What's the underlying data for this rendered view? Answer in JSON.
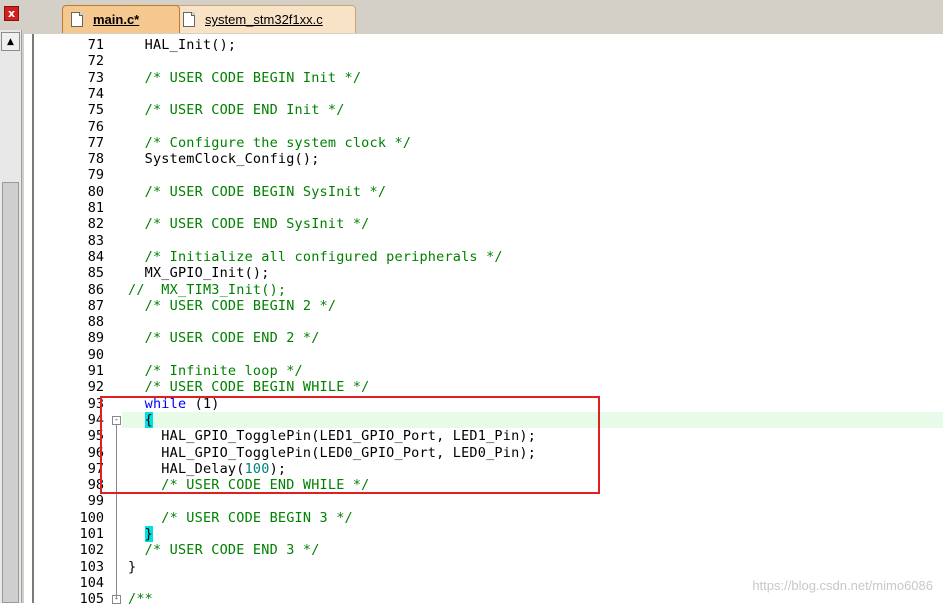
{
  "tabs": [
    {
      "label": "main.c*",
      "active": true
    },
    {
      "label": "system_stm32f1xx.c",
      "active": false
    }
  ],
  "close_label": "x",
  "scroll_up_glyph": "▲",
  "lines": [
    {
      "n": "71",
      "parts": [
        {
          "t": "  HAL_Init();",
          "c": "plain"
        }
      ]
    },
    {
      "n": "72",
      "parts": []
    },
    {
      "n": "73",
      "parts": [
        {
          "t": "  /* USER CODE BEGIN Init */",
          "c": "comment"
        }
      ]
    },
    {
      "n": "74",
      "parts": []
    },
    {
      "n": "75",
      "parts": [
        {
          "t": "  /* USER CODE END Init */",
          "c": "comment"
        }
      ]
    },
    {
      "n": "76",
      "parts": []
    },
    {
      "n": "77",
      "parts": [
        {
          "t": "  /* Configure the system clock */",
          "c": "comment"
        }
      ]
    },
    {
      "n": "78",
      "parts": [
        {
          "t": "  SystemClock_Config();",
          "c": "plain"
        }
      ]
    },
    {
      "n": "79",
      "parts": []
    },
    {
      "n": "80",
      "parts": [
        {
          "t": "  /* USER CODE BEGIN SysInit */",
          "c": "comment"
        }
      ]
    },
    {
      "n": "81",
      "parts": []
    },
    {
      "n": "82",
      "parts": [
        {
          "t": "  /* USER CODE END SysInit */",
          "c": "comment"
        }
      ]
    },
    {
      "n": "83",
      "parts": []
    },
    {
      "n": "84",
      "parts": [
        {
          "t": "  /* Initialize all configured peripherals */",
          "c": "comment"
        }
      ]
    },
    {
      "n": "85",
      "parts": [
        {
          "t": "  MX_GPIO_Init();",
          "c": "plain"
        }
      ]
    },
    {
      "n": "86",
      "parts": [
        {
          "t": "//  MX_TIM3_Init();",
          "c": "comment"
        }
      ]
    },
    {
      "n": "87",
      "parts": [
        {
          "t": "  /* USER CODE BEGIN 2 */",
          "c": "comment"
        }
      ]
    },
    {
      "n": "88",
      "parts": []
    },
    {
      "n": "89",
      "parts": [
        {
          "t": "  /* USER CODE END 2 */",
          "c": "comment"
        }
      ]
    },
    {
      "n": "90",
      "parts": []
    },
    {
      "n": "91",
      "parts": [
        {
          "t": "  /* Infinite loop */",
          "c": "comment"
        }
      ]
    },
    {
      "n": "92",
      "parts": [
        {
          "t": "  /* USER CODE BEGIN WHILE */",
          "c": "comment"
        }
      ]
    },
    {
      "n": "93",
      "parts": [
        {
          "t": "  ",
          "c": "plain"
        },
        {
          "t": "while",
          "c": "kw"
        },
        {
          "t": " (1)",
          "c": "plain"
        }
      ]
    },
    {
      "n": "94",
      "fold": "-",
      "highlight": true,
      "parts": [
        {
          "t": "  ",
          "c": "plain"
        },
        {
          "t": "{",
          "c": "brace"
        }
      ]
    },
    {
      "n": "95",
      "parts": [
        {
          "t": "    HAL_GPIO_TogglePin(LED1_GPIO_Port, LED1_Pin);",
          "c": "plain"
        }
      ]
    },
    {
      "n": "96",
      "parts": [
        {
          "t": "    HAL_GPIO_TogglePin(LED0_GPIO_Port, LED0_Pin);",
          "c": "plain"
        }
      ]
    },
    {
      "n": "97",
      "parts": [
        {
          "t": "    HAL_Delay(",
          "c": "plain"
        },
        {
          "t": "100",
          "c": "num"
        },
        {
          "t": ");",
          "c": "plain"
        }
      ]
    },
    {
      "n": "98",
      "parts": [
        {
          "t": "    /* USER CODE END WHILE */",
          "c": "comment"
        }
      ]
    },
    {
      "n": "99",
      "parts": []
    },
    {
      "n": "100",
      "parts": [
        {
          "t": "    /* USER CODE BEGIN 3 */",
          "c": "comment"
        }
      ]
    },
    {
      "n": "101",
      "parts": [
        {
          "t": "  ",
          "c": "plain"
        },
        {
          "t": "}",
          "c": "brace"
        }
      ]
    },
    {
      "n": "102",
      "parts": [
        {
          "t": "  /* USER CODE END 3 */",
          "c": "comment"
        }
      ]
    },
    {
      "n": "103",
      "parts": [
        {
          "t": "}",
          "c": "plain"
        }
      ]
    },
    {
      "n": "104",
      "parts": []
    },
    {
      "n": "105",
      "fold": "-",
      "parts": [
        {
          "t": "/**",
          "c": "comment"
        }
      ]
    }
  ],
  "watermark": "https://blog.csdn.net/mimo6086"
}
